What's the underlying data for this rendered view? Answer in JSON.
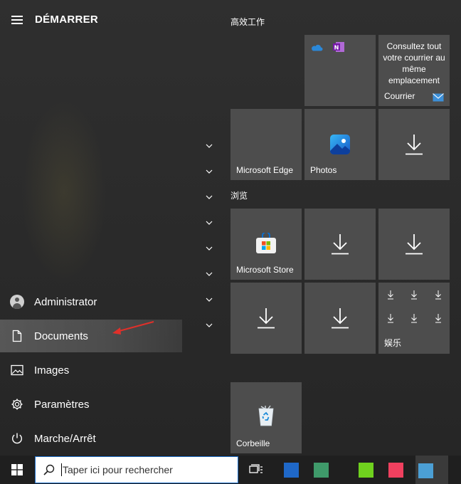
{
  "start_menu": {
    "title": "DÉMARRER",
    "left_items": [
      {
        "label": "Administrator",
        "icon": "user-avatar-icon"
      },
      {
        "label": "Documents",
        "icon": "document-icon"
      },
      {
        "label": "Images",
        "icon": "image-icon"
      },
      {
        "label": "Paramètres",
        "icon": "gear-icon"
      },
      {
        "label": "Marche/Arrêt",
        "icon": "power-icon"
      }
    ],
    "groups": [
      {
        "title": "高效工作"
      },
      {
        "title": "浏览"
      }
    ],
    "tiles": {
      "office_group": {
        "icons": [
          "onedrive-icon",
          "onenote-icon"
        ]
      },
      "mail": {
        "text": "Consultez tout votre courrier au même emplacement",
        "label": "Courrier",
        "icon": "mail-icon"
      },
      "edge": {
        "label": "Microsoft Edge"
      },
      "photos": {
        "label": "Photos",
        "icon": "photos-icon"
      },
      "download_1": {
        "icon": "download-arrow-icon"
      },
      "store": {
        "label": "Microsoft Store",
        "icon": "store-icon"
      },
      "download_2": {
        "icon": "download-arrow-icon"
      },
      "download_3": {
        "icon": "download-arrow-icon"
      },
      "download_4": {
        "icon": "download-arrow-icon"
      },
      "download_5": {
        "icon": "download-arrow-icon"
      },
      "entertainment": {
        "label": "娱乐",
        "icon": "download-arrow-icon"
      },
      "recycle": {
        "label": "Corbeille",
        "icon": "recycle-bin-icon"
      }
    },
    "annotation_arrow_color": "#e0302a"
  },
  "taskbar": {
    "search_placeholder": "Taper ici pour rechercher",
    "apps": [
      {
        "icon": "app-blue-icon",
        "color": "#1f68c8"
      },
      {
        "icon": "app-teal-icon",
        "color": "#3f9a6a"
      },
      {
        "icon": "app-green-icon",
        "color": "#6fd11e"
      },
      {
        "icon": "app-pink-icon",
        "color": "#f0405f"
      },
      {
        "icon": "app-lightblue-icon",
        "color": "#4b9fd5"
      }
    ]
  }
}
